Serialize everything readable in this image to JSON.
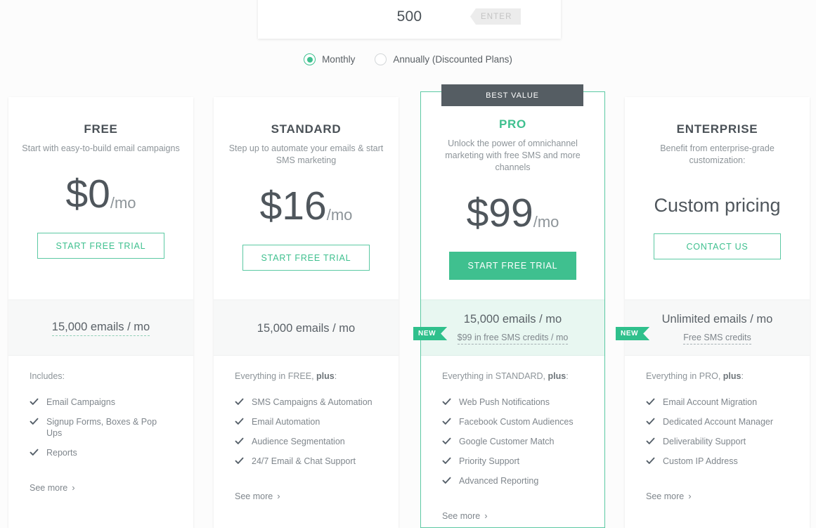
{
  "contacts_panel": {
    "value": "500",
    "enter_label": "ENTER",
    "placeholder": "500"
  },
  "billing": {
    "options": [
      {
        "label": "Monthly",
        "selected": true
      },
      {
        "label": "Annually (Discounted Plans)",
        "selected": false
      }
    ]
  },
  "badges": {
    "best_value": "BEST VALUE",
    "new": "NEW"
  },
  "colors": {
    "accent_green": "#3fc08f",
    "border_green": "#5cc9a3",
    "band_green": "#e8f7f1",
    "ribbon_green": "#2fc08c",
    "best_value_bg": "#555d63",
    "heading_gray": "#4a5157",
    "body_gray": "#8d9499",
    "band_gray": "#f7f8f8"
  },
  "plans": [
    {
      "name": "FREE",
      "desc": "Start with easy-to-build email campaigns",
      "price_main": "$0",
      "price_unit": "/mo",
      "cta": "START FREE TRIAL",
      "emails_main": "15,000 emails / mo",
      "emails_sub": null,
      "features_title_prefix": "Includes:",
      "features_title_bold": "",
      "features_title_suffix": "",
      "features": [
        "Email Campaigns",
        "Signup Forms, Boxes & Pop Ups",
        "Reports"
      ],
      "see_more": "See more"
    },
    {
      "name": "STANDARD",
      "desc": "Step up to automate your emails & start SMS marketing",
      "price_main": "$16",
      "price_unit": "/mo",
      "cta": "START FREE TRIAL",
      "emails_main": "15,000 emails / mo",
      "emails_sub": null,
      "features_title_prefix": "Everything in FREE, ",
      "features_title_bold": "plus",
      "features_title_suffix": ":",
      "features": [
        "SMS Campaigns & Automation",
        "Email Automation",
        "Audience Segmentation",
        "24/7 Email & Chat Support"
      ],
      "see_more": "See more"
    },
    {
      "name": "PRO",
      "desc": "Unlock the power of omnichannel marketing with free SMS and more channels",
      "price_main": "$99",
      "price_unit": "/mo",
      "cta": "START FREE TRIAL",
      "emails_main": "15,000 emails / mo",
      "emails_sub": "$99 in free SMS credits / mo",
      "features_title_prefix": "Everything in STANDARD, ",
      "features_title_bold": "plus",
      "features_title_suffix": ":",
      "features": [
        "Web Push Notifications",
        "Facebook Custom Audiences",
        "Google Customer Match",
        "Priority Support",
        "Advanced Reporting"
      ],
      "see_more": "See more"
    },
    {
      "name": "ENTERPRISE",
      "desc": "Benefit from enterprise-grade customization:",
      "price_main": "Custom pricing",
      "price_unit": "",
      "cta": "CONTACT US",
      "emails_main": "Unlimited emails / mo",
      "emails_sub": "Free SMS credits",
      "features_title_prefix": "Everything in PRO, ",
      "features_title_bold": "plus",
      "features_title_suffix": ":",
      "features": [
        "Email Account Migration",
        "Dedicated Account Manager",
        "Deliverability Support",
        "Custom IP Address"
      ],
      "see_more": "See more"
    }
  ]
}
